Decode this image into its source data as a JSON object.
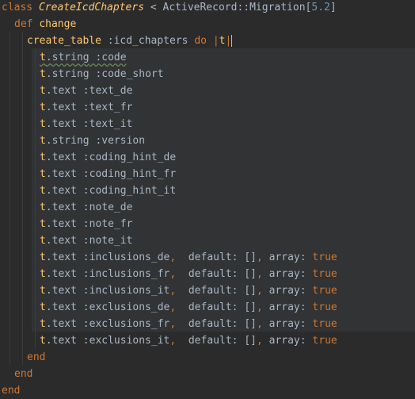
{
  "editor": {
    "lines": [
      {
        "parts": [
          "class",
          " ",
          "CreateIcdChapters",
          " < ",
          "ActiveRecord",
          "::",
          "Migration",
          "[",
          "5.2",
          "]"
        ]
      },
      {
        "parts": [
          "def",
          " ",
          "change"
        ]
      },
      {
        "parts": [
          "create_table",
          " ",
          ":icd_chapters",
          " ",
          "do",
          " ",
          "|",
          "t",
          "|"
        ]
      },
      {
        "parts": [
          "t",
          ".",
          "string",
          " :code"
        ]
      },
      {
        "parts": [
          "t",
          ".",
          "string",
          " :code_short"
        ]
      },
      {
        "parts": [
          "t",
          ".",
          "text",
          " :text_de"
        ]
      },
      {
        "parts": [
          "t",
          ".",
          "text",
          " :text_fr"
        ]
      },
      {
        "parts": [
          "t",
          ".",
          "text",
          " :text_it"
        ]
      },
      {
        "parts": [
          "t",
          ".",
          "string",
          " :version"
        ]
      },
      {
        "parts": [
          "t",
          ".",
          "text",
          " :coding_hint_de"
        ]
      },
      {
        "parts": [
          "t",
          ".",
          "text",
          " :coding_hint_fr"
        ]
      },
      {
        "parts": [
          "t",
          ".",
          "text",
          " :coding_hint_it"
        ]
      },
      {
        "parts": [
          "t",
          ".",
          "text",
          " :note_de"
        ]
      },
      {
        "parts": [
          "t",
          ".",
          "text",
          " :note_fr"
        ]
      },
      {
        "parts": [
          "t",
          ".",
          "text",
          " :note_it"
        ]
      },
      {
        "parts": [
          "t",
          ".",
          "text",
          " :inclusions_de",
          ",",
          "  default",
          ": ",
          "[]",
          ",",
          " array",
          ": ",
          "true"
        ]
      },
      {
        "parts": [
          "t",
          ".",
          "text",
          " :inclusions_fr",
          ",",
          "  default",
          ": ",
          "[]",
          ",",
          " array",
          ": ",
          "true"
        ]
      },
      {
        "parts": [
          "t",
          ".",
          "text",
          " :inclusions_it",
          ",",
          "  default",
          ": ",
          "[]",
          ",",
          " array",
          ": ",
          "true"
        ]
      },
      {
        "parts": [
          "t",
          ".",
          "text",
          " :exclusions_de",
          ",",
          "  default",
          ": ",
          "[]",
          ",",
          " array",
          ": ",
          "true"
        ]
      },
      {
        "parts": [
          "t",
          ".",
          "text",
          " :exclusions_fr",
          ",",
          "  default",
          ": ",
          "[]",
          ",",
          " array",
          ": ",
          "true"
        ]
      },
      {
        "parts": [
          "t",
          ".",
          "text",
          " :exclusions_it",
          ",",
          "  default",
          ": ",
          "[]",
          ",",
          " array",
          ": ",
          "true"
        ]
      },
      {
        "parts": [
          "end"
        ]
      },
      {
        "parts": [
          "end"
        ]
      },
      {
        "parts": [
          "end"
        ]
      }
    ]
  }
}
